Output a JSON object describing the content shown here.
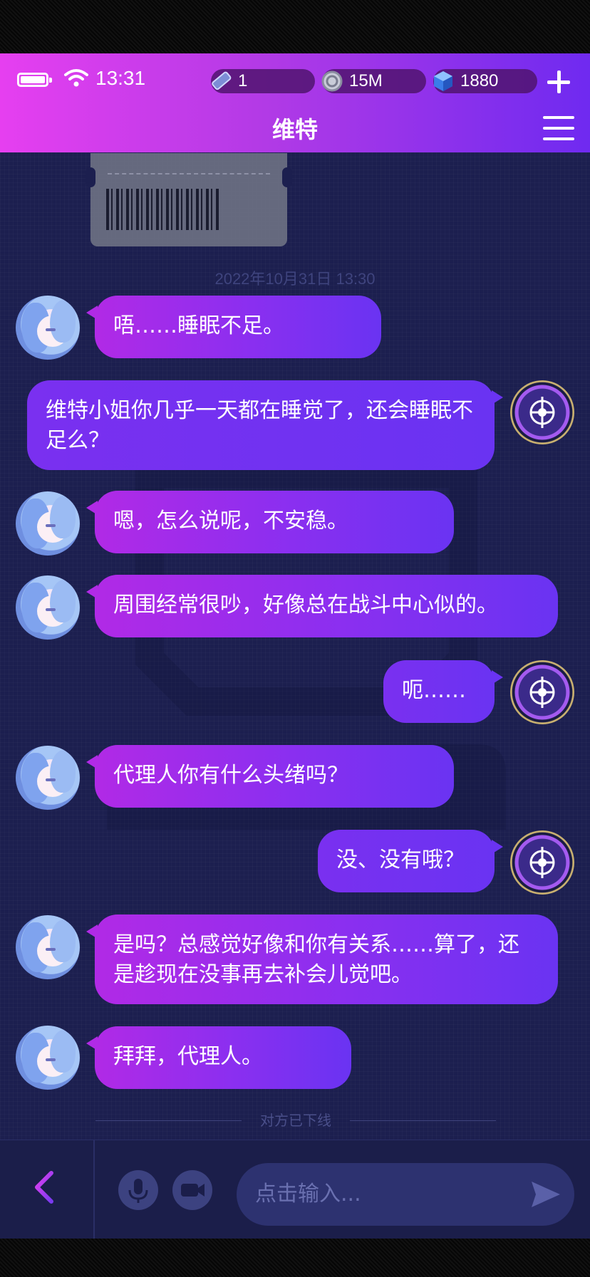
{
  "status_bar": {
    "time": "13:31"
  },
  "resources": [
    {
      "icon": "ticket-icon",
      "value": "1"
    },
    {
      "icon": "coin-icon",
      "value": "15M"
    },
    {
      "icon": "cube-gem-icon",
      "value": "1880"
    }
  ],
  "header": {
    "title": "维特"
  },
  "chat": {
    "timestamp": "2022年10月31日 13:30",
    "messages": [
      {
        "side": "left",
        "text": "唔……睡眠不足。"
      },
      {
        "side": "right",
        "text": "维特小姐你几乎一天都在睡觉了，还会睡眠不足么？"
      },
      {
        "side": "left",
        "text": "嗯，怎么说呢，不安稳。"
      },
      {
        "side": "left",
        "text": "周围经常很吵，好像总在战斗中心似的。"
      },
      {
        "side": "right",
        "text": "呃……"
      },
      {
        "side": "left",
        "text": "代理人你有什么头绪吗？"
      },
      {
        "side": "right",
        "text": "没、没有哦？"
      },
      {
        "side": "left",
        "text": "是吗？总感觉好像和你有关系……算了，还是趁现在没事再去补会儿觉吧。"
      },
      {
        "side": "left",
        "text": "拜拜，代理人。"
      }
    ],
    "offline_notice": "对方已下线"
  },
  "input": {
    "placeholder": "点击输入..."
  },
  "colors": {
    "header_start": "#e63ff0",
    "header_end": "#6f2af0",
    "bubble_start": "#b12ae6",
    "bubble_end": "#6a33f2",
    "background": "#1c1f4f"
  }
}
